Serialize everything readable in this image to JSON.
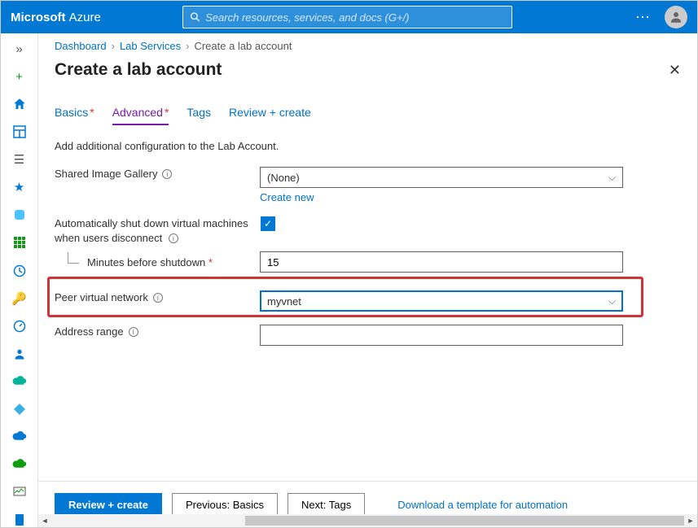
{
  "header": {
    "brand_bold": "Microsoft",
    "brand_light": "Azure",
    "search_placeholder": "Search resources, services, and docs (G+/)"
  },
  "breadcrumb": {
    "items": [
      "Dashboard",
      "Lab Services"
    ],
    "current": "Create a lab account"
  },
  "page": {
    "title": "Create a lab account"
  },
  "tabs": {
    "basics": "Basics",
    "advanced": "Advanced",
    "tags": "Tags",
    "review": "Review + create"
  },
  "form": {
    "intro": "Add additional configuration to the Lab Account.",
    "shared_image_gallery_label": "Shared Image Gallery",
    "shared_image_gallery_value": "(None)",
    "create_new": "Create new",
    "auto_shutdown_label": "Automatically shut down virtual machines when users disconnect",
    "auto_shutdown_checked": true,
    "minutes_label": "Minutes before shutdown",
    "minutes_value": "15",
    "peer_vnet_label": "Peer virtual network",
    "peer_vnet_value": "myvnet",
    "address_range_label": "Address range",
    "address_range_value": ""
  },
  "footer": {
    "review": "Review + create",
    "previous": "Previous: Basics",
    "next": "Next: Tags",
    "download": "Download a template for automation"
  }
}
